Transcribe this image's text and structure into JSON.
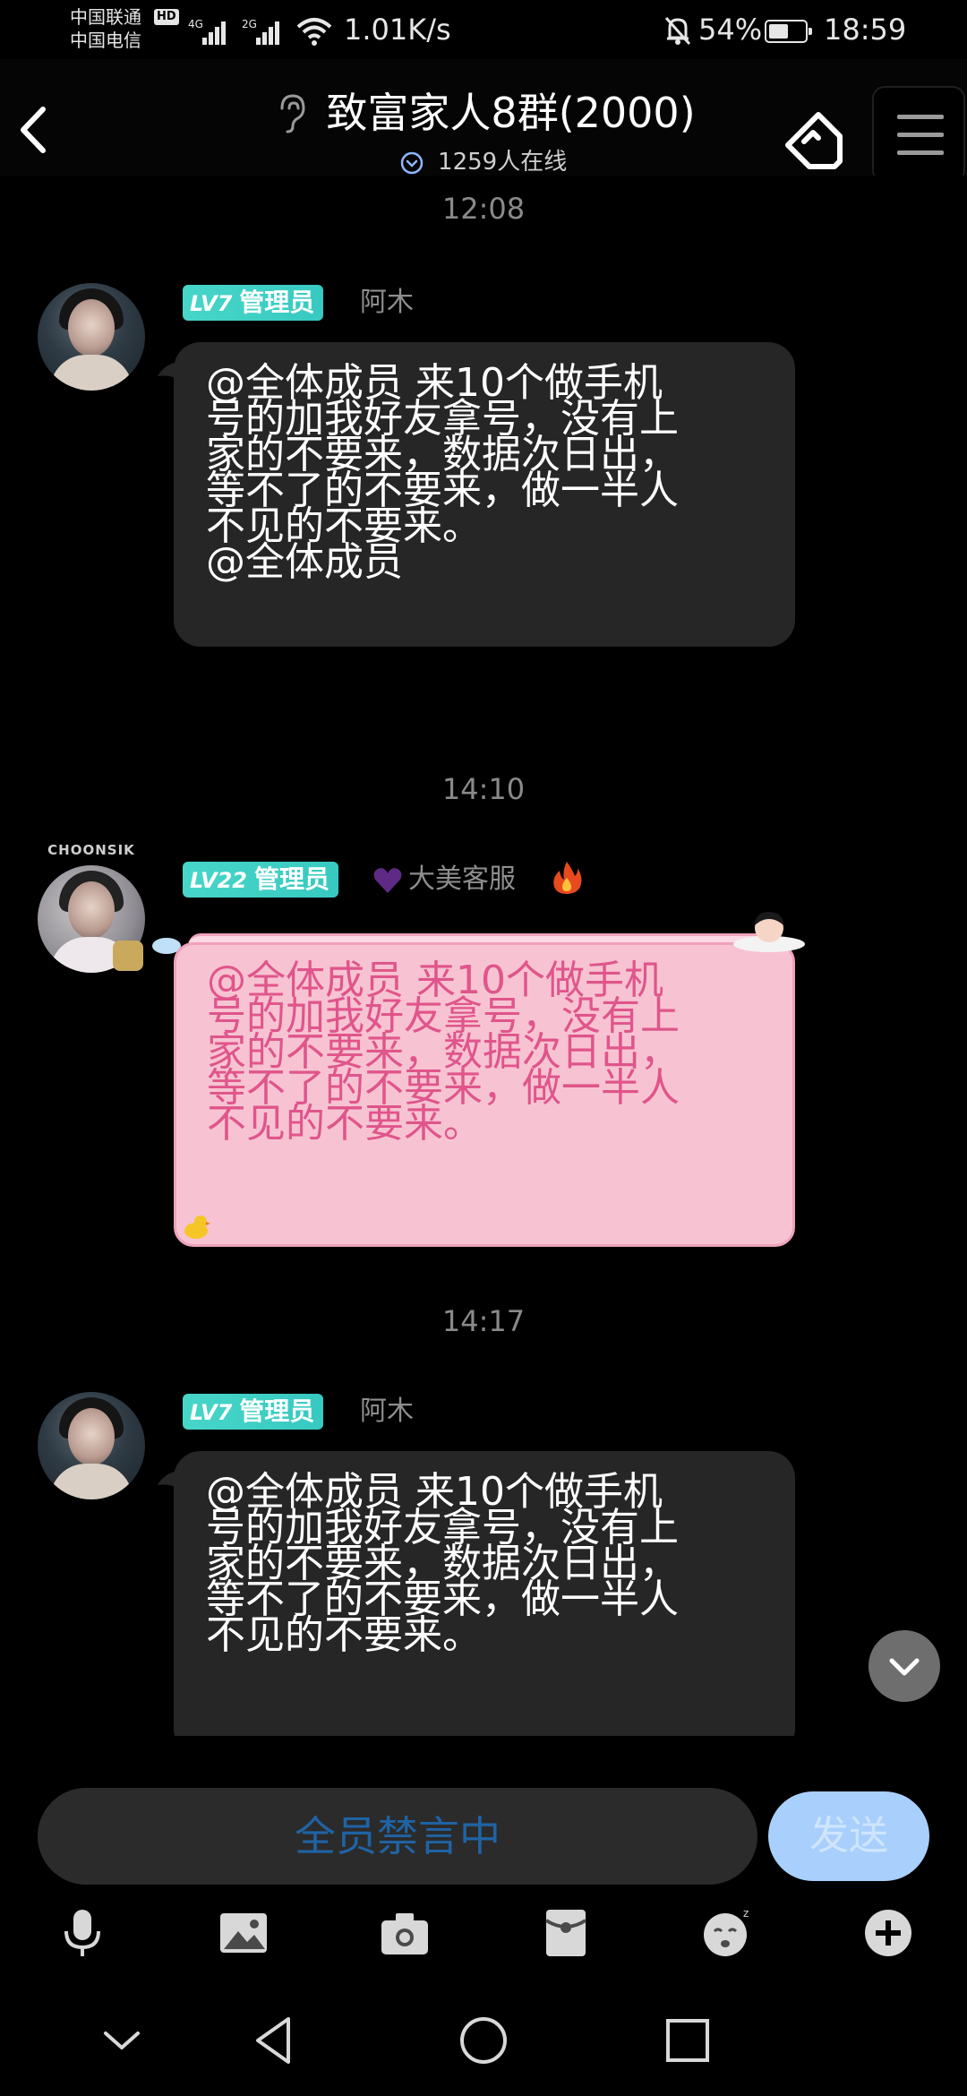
{
  "status_bar": {
    "carrier_1": "中国联通",
    "hd_label": "HD",
    "carrier_2": "中国电信",
    "net_tag_1": "4G",
    "net_tag_2": "2G",
    "speed": "1.01K/s",
    "battery_percent": "54%",
    "battery_level": 0.54,
    "time": "18:59"
  },
  "header": {
    "title": "致富家人8群(2000)",
    "online": "1259人在线",
    "icons": {
      "back": "chevron-left-icon",
      "ear": "ear-icon",
      "tag": "tag-icon",
      "menu": "hamburger-menu-icon"
    }
  },
  "messages": [
    {
      "timestamp": "12:08",
      "level": "LV7",
      "role": "管理员",
      "sender": "阿木",
      "lines": [
        "@全体成员 来10个做手机",
        "号的加我好友拿号，没有上",
        "家的不要来，数据次日出，",
        "等不了的不要来，做一半人",
        "不见的不要来。",
        "@全体成员"
      ]
    },
    {
      "timestamp": "14:10",
      "level": "LV22",
      "role": "管理员",
      "sender": "大美客服",
      "avatar_frame_text": "CHOONSIK",
      "lines": [
        "@全体成员 来10个做手机",
        "号的加我好友拿号，没有上",
        "家的不要来，数据次日出，",
        "等不了的不要来，做一半人",
        "不见的不要来。"
      ]
    },
    {
      "timestamp": "14:17",
      "level": "LV7",
      "role": "管理员",
      "sender": "阿木",
      "lines": [
        "@全体成员 来10个做手机",
        "号的加我好友拿号，没有上",
        "家的不要来，数据次日出，",
        "等不了的不要来，做一半人",
        "不见的不要来。"
      ]
    }
  ],
  "input": {
    "placeholder": "全员禁言中",
    "send_label": "发送"
  },
  "toolbar": [
    "microphone-icon",
    "image-icon",
    "camera-icon",
    "red-packet-icon",
    "emoji-icon",
    "plus-icon"
  ],
  "navbar": [
    "chevron-down-icon",
    "back-triangle-icon",
    "home-circle-icon",
    "recents-square-icon"
  ],
  "colors": {
    "badge": "#37c9c1",
    "bubble": "#262626",
    "pink_bubble": "#f7c3d2",
    "pink_text": "#e0558b",
    "send": "#a9cffc",
    "placeholder": "#1f63a4"
  }
}
